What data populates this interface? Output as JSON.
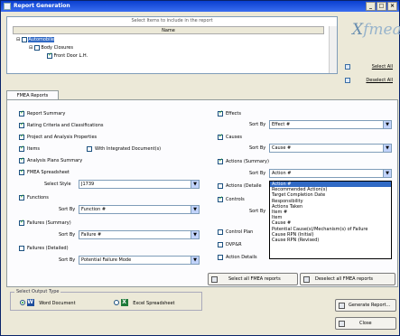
{
  "window": {
    "title": "Report Generation",
    "controls": [
      "_",
      "□",
      "×"
    ]
  },
  "tree": {
    "instruction": "Select Items to include in the report",
    "column_header": "Name",
    "items": [
      {
        "label": "Automobile",
        "checked": false,
        "selected": true
      },
      {
        "label": "Body Closures",
        "checked": false,
        "selected": false
      },
      {
        "label": "Front Door L.H.",
        "checked": true,
        "selected": false
      }
    ]
  },
  "logo": {
    "text": "Xfmea"
  },
  "side_buttons": {
    "select_all": "Select All",
    "deselect_all": "Deselect All"
  },
  "tab": {
    "label": "FMEA Reports"
  },
  "left_options": {
    "report_summary": "Report Summary",
    "rating_criteria": "Rating Criteria and Classifications",
    "project_props": "Project and Analysis Properties",
    "items": "Items",
    "with_integrated_docs": "With Integrated Document(s)",
    "analysis_plans": "Analysis Plans Summary",
    "fmea_spreadsheet": "FMEA Spreadsheet",
    "select_style_label": "Select Style",
    "select_style_value": "J1739",
    "functions": "Functions",
    "sort_by_label": "Sort By",
    "functions_sort": "Function #",
    "failures_summary": "Failures (Summary)",
    "failures_sort": "Failure #",
    "failures_detailed": "Failures (Detailed)",
    "failures_detailed_sort": "Potential Failure Mode"
  },
  "right_options": {
    "effects": "Effects",
    "effects_sort": "Effect #",
    "causes": "Causes",
    "causes_sort": "Cause #",
    "actions_summary": "Actions (Summary)",
    "actions_sort": "Action #",
    "actions_detailed": "Actions (Detaile",
    "controls": "Controls",
    "control_plan": "Control Plan",
    "dvpr": "DVP&R",
    "action_details": "Action Details",
    "sort_by_label": "Sort By"
  },
  "dropdown_options": [
    "Action #",
    "Recommended Action(s)",
    "Target Completion Date",
    "Responsibility",
    "Actions Taken",
    "Item #",
    "Item",
    "Cause #",
    "Potential Cause(s)/Mechanism(s) of Failure",
    "Cause RPN (Initial)",
    "Cause RPN (Revised)"
  ],
  "panel_buttons": {
    "select_all_fmea": "Select all FMEA reports",
    "deselect_all_fmea": "Deselect all FMEA reports"
  },
  "output_type": {
    "group_label": "Select Output Type",
    "word": "Word Document",
    "excel": "Excel Spreadsheet",
    "word_icon": "W",
    "excel_icon": "X"
  },
  "bottom_buttons": {
    "generate": "Generate Report...",
    "close": "Close"
  },
  "colors": {
    "titlebar": "#0a3fd0",
    "selection": "#316ac5",
    "check": "#21a121"
  }
}
